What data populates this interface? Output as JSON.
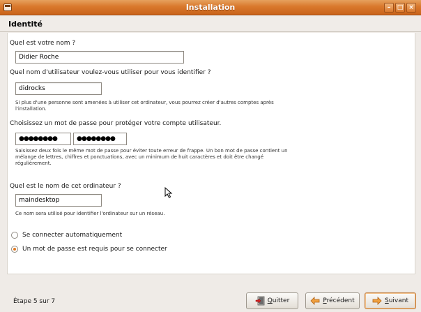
{
  "window": {
    "title": "Installation"
  },
  "header": {
    "title": "Identité"
  },
  "form": {
    "name_label": "Quel est votre nom ?",
    "name_value": "Didier Roche",
    "username_label": "Quel nom d'utilisateur voulez-vous utiliser pour vous identifier ?",
    "username_value": "didrocks",
    "username_hint_line1": "Si plus d'une personne sont amenées à utiliser cet ordinateur, vous pourrez créer d'autres comptes après",
    "username_hint_line2": "l'installation.",
    "password_label": "Choisissez un mot de passe pour protéger votre compte utilisateur.",
    "password_value": "●●●●●●●●",
    "password_confirm_value": "●●●●●●●●",
    "password_hint_line1": "Saisissez deux fois le même mot de passe pour éviter toute erreur de frappe. Un bon mot de passe contient un",
    "password_hint_line2": "mélange de lettres, chiffres et ponctuations, avec un minimum de huit caractères et doit être changé",
    "password_hint_line3": "régulièrement.",
    "hostname_label": "Quel est le nom de cet ordinateur ?",
    "hostname_value": "maindesktop",
    "hostname_hint": "Ce nom sera utilisé pour identifier l'ordinateur sur un réseau.",
    "login_options": [
      {
        "label": "Se connecter automatiquement",
        "checked": false
      },
      {
        "label": "Un mot de passe est requis pour se connecter",
        "checked": true
      }
    ]
  },
  "footer": {
    "step": "Étape 5 sur 7",
    "quit_label_first": "Q",
    "quit_label_rest": "uitter",
    "prev_label_first": "P",
    "prev_label_rest": "récédent",
    "next_label_first": "S",
    "next_label_rest": "uivant"
  },
  "colors": {
    "accent": "#d9782c",
    "titlebar": "#c9631a"
  },
  "icons": [
    "window-menu-icon",
    "minimize-icon",
    "maximize-icon",
    "close-icon",
    "quit-icon",
    "back-arrow-icon",
    "forward-arrow-icon",
    "mouse-cursor-icon"
  ]
}
